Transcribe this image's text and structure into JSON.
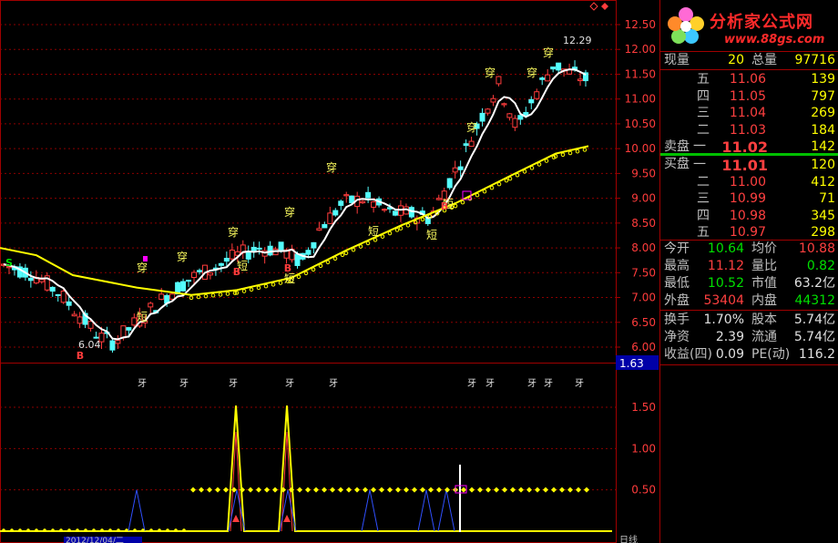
{
  "chart": {
    "price_ticks": [
      "12.50",
      "12.00",
      "11.50",
      "11.00",
      "10.50",
      "10.00",
      "9.50",
      "9.00",
      "8.50",
      "8.00",
      "7.50",
      "7.00",
      "6.50",
      "6.00"
    ],
    "ind_ticks": [
      "1.50",
      "1.00",
      "0.50"
    ],
    "ind_current": "1.63",
    "high_label": "12.29",
    "low_label": "6.04",
    "date_label": "2012/12/04/二",
    "period_label": "日线",
    "annotations": {
      "chuan": "穿",
      "duan": "短",
      "buy": "B",
      "sell": "S",
      "ya": "牙"
    },
    "colors": {
      "up": "#ff3c3c",
      "down": "#54fcfc",
      "ma_short": "#ffffff",
      "ma_long": "#ffff00",
      "grid": "#8b0000",
      "axis_text": "#ff3c3c",
      "indicator_line": "#ffff00",
      "indicator_peak": "#3050ff",
      "marker": "#ff00ff"
    }
  },
  "panel": {
    "logo_title": "分析家公式网",
    "logo_url": "www.88gs.com",
    "now_volume_label": "现量",
    "now_volume": "20",
    "total_volume_label": "总量",
    "total_volume": "97716",
    "sell_label": "卖盘",
    "buy_label": "买盘",
    "asks": [
      {
        "level": "五",
        "price": "11.06",
        "vol": "139"
      },
      {
        "level": "四",
        "price": "11.05",
        "vol": "797"
      },
      {
        "level": "三",
        "price": "11.04",
        "vol": "269"
      },
      {
        "level": "二",
        "price": "11.03",
        "vol": "184"
      },
      {
        "level": "一",
        "price": "11.02",
        "vol": "142"
      }
    ],
    "bids": [
      {
        "level": "一",
        "price": "11.01",
        "vol": "120"
      },
      {
        "level": "二",
        "price": "11.00",
        "vol": "412"
      },
      {
        "level": "三",
        "price": "10.99",
        "vol": "71"
      },
      {
        "level": "四",
        "price": "10.98",
        "vol": "345"
      },
      {
        "level": "五",
        "price": "10.97",
        "vol": "298"
      }
    ],
    "stats": [
      {
        "l1": "今开",
        "v1": "10.64",
        "c1": "green",
        "l2": "均价",
        "v2": "10.88",
        "c2": "red"
      },
      {
        "l1": "最高",
        "v1": "11.12",
        "c1": "red",
        "l2": "量比",
        "v2": "0.82",
        "c2": "green"
      },
      {
        "l1": "最低",
        "v1": "10.52",
        "c1": "green",
        "l2": "市值",
        "v2": "63.2亿",
        "c2": "white"
      },
      {
        "l1": "外盘",
        "v1": "53404",
        "c1": "red",
        "l2": "内盘",
        "v2": "44312",
        "c2": "green"
      }
    ],
    "fin": [
      {
        "l1": "换手",
        "v1": "1.70%",
        "l2": "股本",
        "v2": "5.74亿"
      },
      {
        "l1": "净资",
        "v1": "2.39",
        "l2": "流通",
        "v2": "5.74亿"
      },
      {
        "l1": "收益(四)",
        "v1": "0.09",
        "l2": "PE(动)",
        "v2": "116.2"
      }
    ]
  }
}
